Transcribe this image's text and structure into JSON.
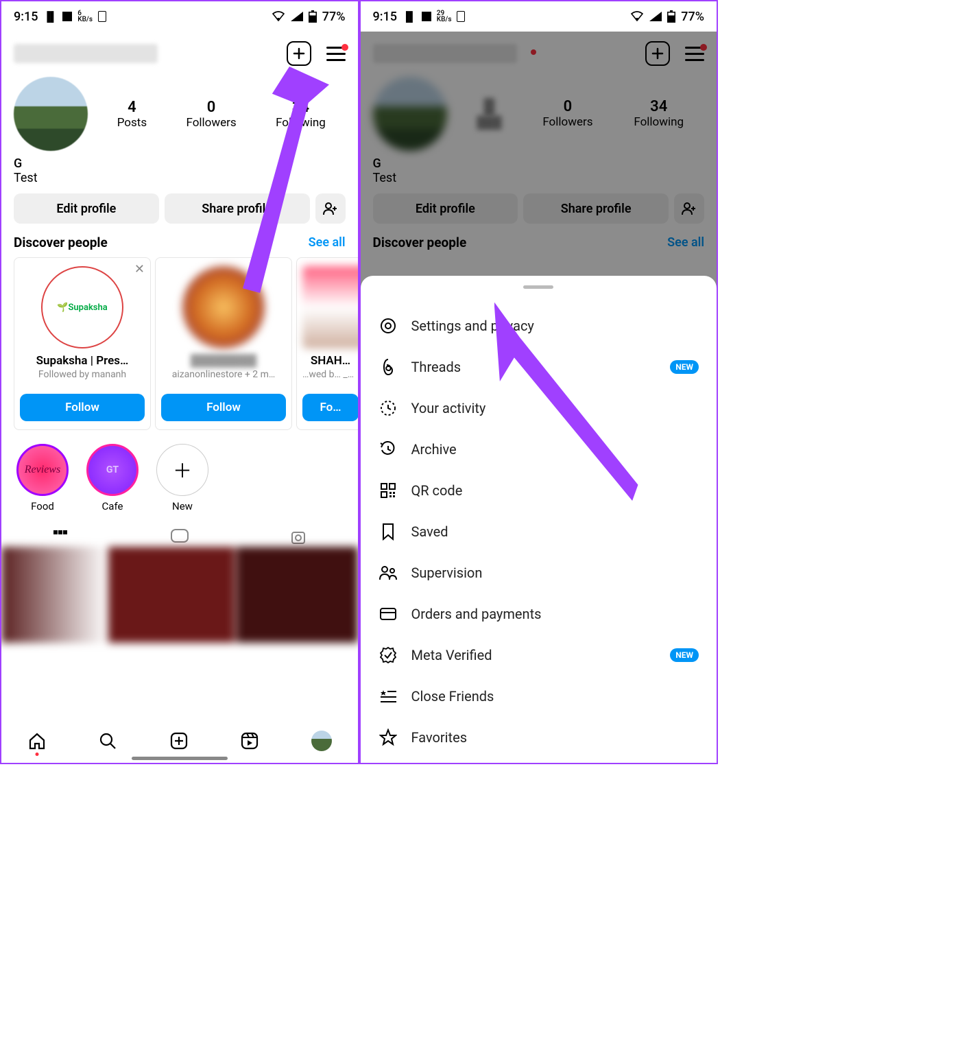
{
  "status": {
    "time": "9:15",
    "kb_left": "6",
    "kb_right": "29",
    "kb_unit": "KB/s",
    "battery": "77%"
  },
  "profile": {
    "name": "G",
    "bio": "Test",
    "stats": {
      "posts_n": "4",
      "posts_l": "Posts",
      "followers_n": "0",
      "followers_l": "Followers",
      "following_n": "34",
      "following_l": "Following"
    },
    "edit": "Edit profile",
    "share": "Share profile"
  },
  "discover": {
    "title": "Discover people",
    "seeall": "See all",
    "cards": [
      {
        "name": "Supaksha | Pres…",
        "sub": "Followed by mananh",
        "img_label": "Supaksha",
        "follow": "Follow"
      },
      {
        "name": "",
        "sub": "aizanonlinestore + 2 m…",
        "follow": "Follow"
      },
      {
        "name": "SHAH…",
        "sub": "…wed b… _by_naj…",
        "follow": "Fo…"
      }
    ]
  },
  "highlights": [
    {
      "label": "Food",
      "inner": "Reviews"
    },
    {
      "label": "Cafe",
      "inner": "GT"
    },
    {
      "label": "New",
      "inner": "＋"
    }
  ],
  "sheet": {
    "items": [
      {
        "icon": "settings",
        "label": "Settings and privacy"
      },
      {
        "icon": "threads",
        "label": "Threads",
        "badge": "NEW"
      },
      {
        "icon": "activity",
        "label": "Your activity"
      },
      {
        "icon": "archive",
        "label": "Archive"
      },
      {
        "icon": "qr",
        "label": "QR code"
      },
      {
        "icon": "saved",
        "label": "Saved"
      },
      {
        "icon": "supervision",
        "label": "Supervision"
      },
      {
        "icon": "orders",
        "label": "Orders and payments"
      },
      {
        "icon": "meta",
        "label": "Meta Verified",
        "badge": "NEW"
      },
      {
        "icon": "closefriends",
        "label": "Close Friends"
      },
      {
        "icon": "favorites",
        "label": "Favorites"
      }
    ]
  }
}
